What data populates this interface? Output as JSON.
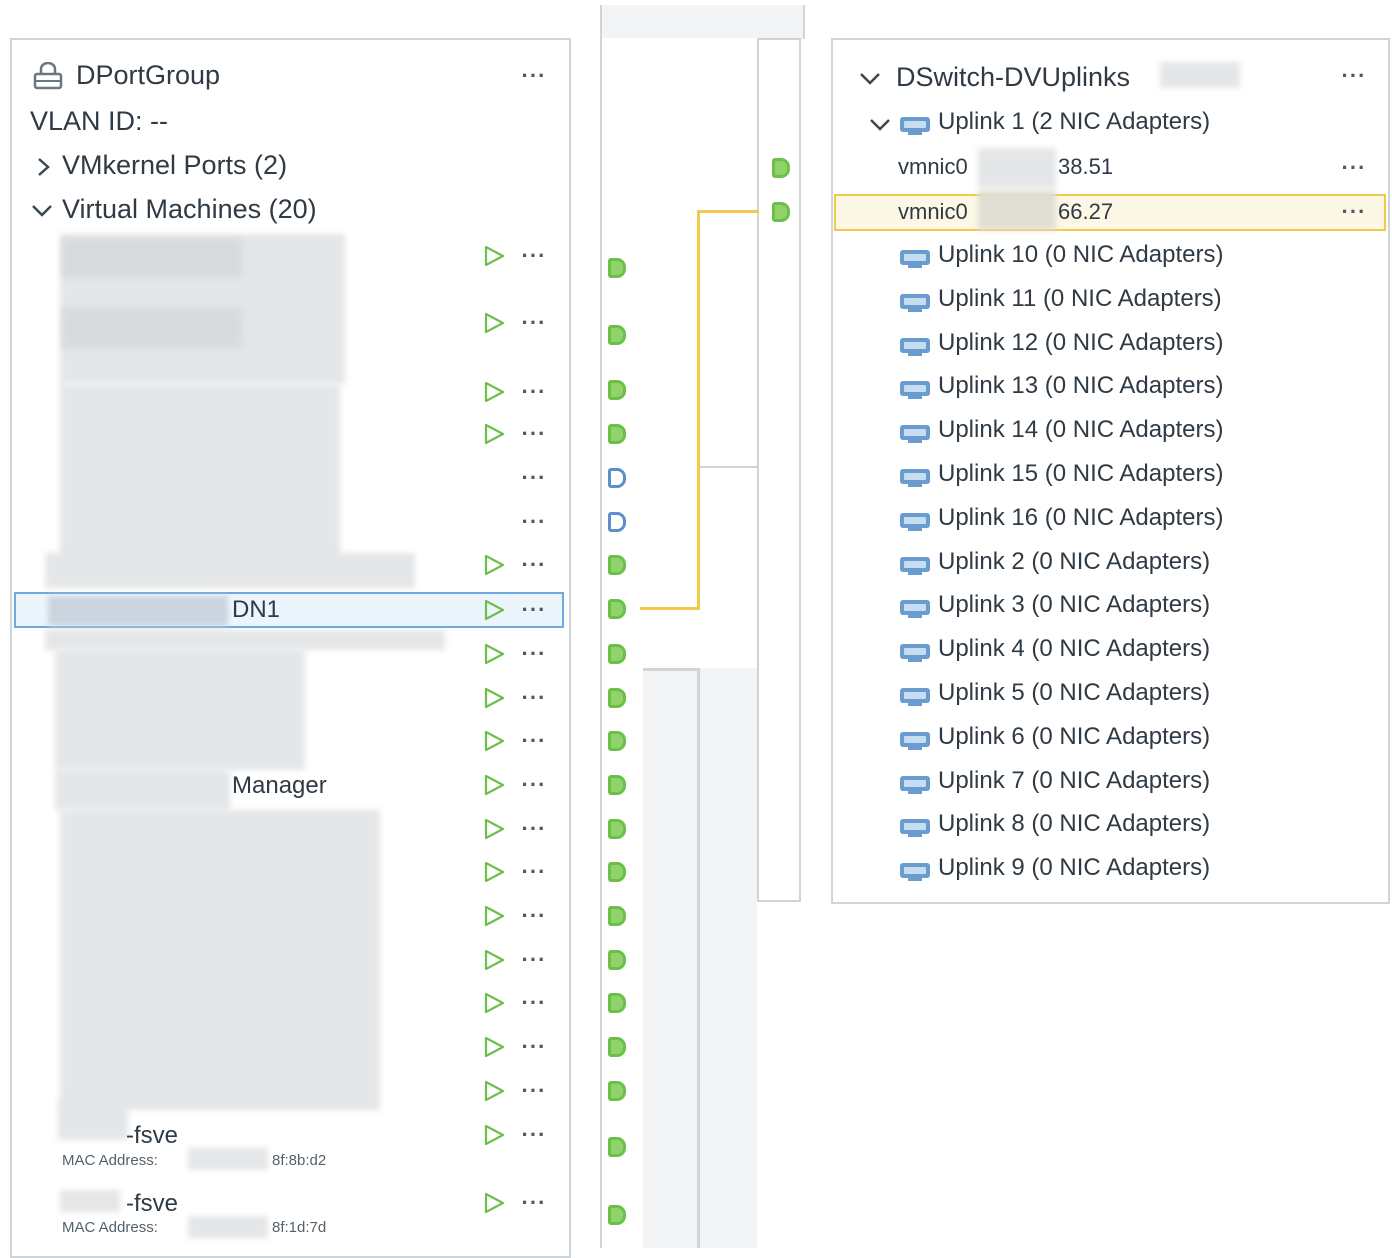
{
  "portgroup": {
    "title": "DPortGroup",
    "vlan": "VLAN ID: --",
    "vmkernel": "VMkernel Ports (2)",
    "vms": "Virtual Machines (20)",
    "more": "···",
    "selected_vm_suffix": "DN1",
    "manager_suffix": "Manager",
    "fsve_1": "-fsve",
    "fsve_1_mac_label": "MAC Address:",
    "fsve_1_mac_tail": "8f:8b:d2",
    "fsve_2": "-fsve",
    "fsve_2_mac_label": "MAC Address:",
    "fsve_2_mac_tail": "8f:1d:7d"
  },
  "uplinks": {
    "title": "DSwitch-DVUplinks",
    "uplink1": "Uplink 1 (2 NIC Adapters)",
    "nic1_prefix": "vmnic0",
    "nic1_tail": "38.51",
    "nic2_prefix": "vmnic0",
    "nic2_tail": "66.27",
    "items": [
      "Uplink 10 (0 NIC Adapters)",
      "Uplink 11 (0 NIC Adapters)",
      "Uplink 12 (0 NIC Adapters)",
      "Uplink 13 (0 NIC Adapters)",
      "Uplink 14 (0 NIC Adapters)",
      "Uplink 15 (0 NIC Adapters)",
      "Uplink 16 (0 NIC Adapters)",
      "Uplink 2 (0 NIC Adapters)",
      "Uplink 3 (0 NIC Adapters)",
      "Uplink 4 (0 NIC Adapters)",
      "Uplink 5 (0 NIC Adapters)",
      "Uplink 6 (0 NIC Adapters)",
      "Uplink 7 (0 NIC Adapters)",
      "Uplink 8 (0 NIC Adapters)",
      "Uplink 9 (0 NIC Adapters)"
    ]
  },
  "colors": {
    "highlight": "#f2c94c",
    "selection": "#6fa8dc",
    "port_green": "#8fd36a",
    "uplink_icon": "#6a9ccf"
  }
}
